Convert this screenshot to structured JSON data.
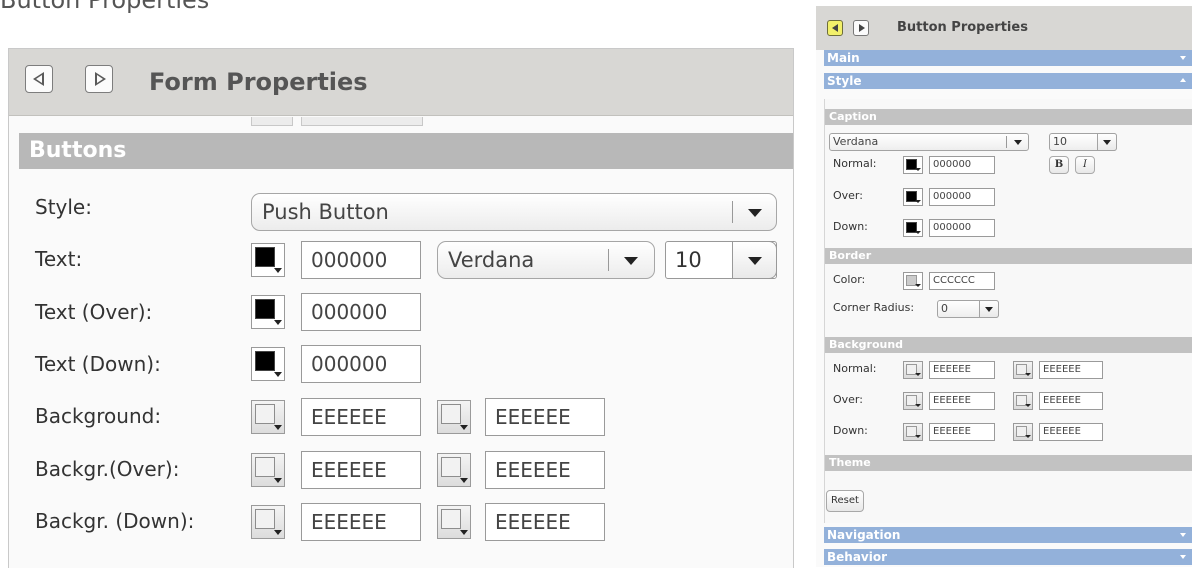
{
  "top_note": "Button Properties",
  "form_panel": {
    "title": "Form Properties",
    "section_title": "Buttons",
    "rows": {
      "style": {
        "label": "Style:",
        "value": "Push Button"
      },
      "text": {
        "label": "Text:",
        "color": "000000",
        "font": "Verdana",
        "size": "10"
      },
      "text_over": {
        "label": "Text (Over):",
        "color": "000000"
      },
      "text_down": {
        "label": "Text (Down):",
        "color": "000000"
      },
      "background": {
        "label": "Background:",
        "color1": "EEEEEE",
        "color2": "EEEEEE"
      },
      "background_over": {
        "label": "Backgr.(Over):",
        "color1": "EEEEEE",
        "color2": "EEEEEE"
      },
      "background_down": {
        "label": "Backgr. (Down):",
        "color1": "EEEEEE",
        "color2": "EEEEEE"
      }
    }
  },
  "button_panel": {
    "title": "Button Properties",
    "accordion": {
      "main": "Main",
      "style": "Style",
      "navigation": "Navigation",
      "behavior": "Behavior"
    },
    "caption": {
      "title": "Caption",
      "font": "Verdana",
      "size": "10",
      "normal_label": "Normal:",
      "normal_color": "000000",
      "over_label": "Over:",
      "over_color": "000000",
      "down_label": "Down:",
      "down_color": "000000",
      "bold_label": "B",
      "italic_label": "I"
    },
    "border": {
      "title": "Border",
      "color_label": "Color:",
      "color_value": "CCCCCC",
      "radius_label": "Corner Radius:",
      "radius_value": "0"
    },
    "background": {
      "title": "Background",
      "normal_label": "Normal:",
      "normal_1": "EEEEEE",
      "normal_2": "EEEEEE",
      "over_label": "Over:",
      "over_1": "EEEEEE",
      "over_2": "EEEEEE",
      "down_label": "Down:",
      "down_1": "EEEEEE",
      "down_2": "EEEEEE"
    },
    "theme": {
      "title": "Theme",
      "reset_label": "Reset"
    }
  },
  "colors": {
    "accordion_blue": "#93b1da",
    "section_gray": "#c2c2c2",
    "header_gray": "#d8d7d4",
    "active_nav": "#f2f06a"
  }
}
